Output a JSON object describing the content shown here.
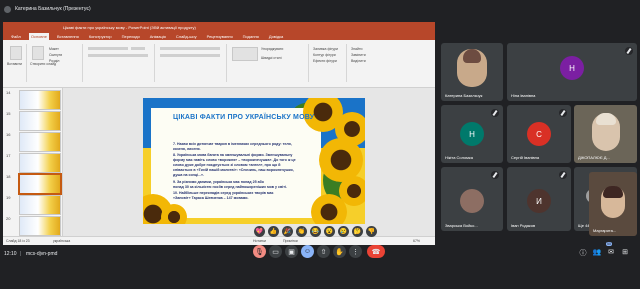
{
  "presenter": {
    "name": "Катерина Базильчук (Презентує)"
  },
  "powerpoint": {
    "window_title": "Цікаві факти про українську мову - PowerPoint (Збій активації продукту)",
    "tabs": [
      "Файл",
      "Основне",
      "Вставлення",
      "Конструктор",
      "Переходи",
      "Анімація",
      "Слайд-шоу",
      "Рецензування",
      "Подання",
      "Довідка"
    ],
    "ribbon_labels": {
      "paste": "Вставити",
      "new_slide": "Створити слайд",
      "layout": "Макет",
      "reset": "Скинути",
      "section": "Розділ",
      "arrange": "Упорядкувати",
      "quick_styles": "Швидкі стилі",
      "shape_fill": "Заливка фігури",
      "shape_outline": "Контур фігури",
      "shape_effects": "Ефекти фігури",
      "find": "Знайти",
      "replace": "Замінити",
      "select": "Виділити"
    },
    "thumb_numbers": [
      "14",
      "15",
      "16",
      "17",
      "18",
      "19",
      "20"
    ],
    "slide": {
      "heading": "ЦІКАВІ ФАКТИ ПРО УКРАЇНСЬКУ МОВУ",
      "lines": [
        "7.  Назви всіх дитинчат тварин в іменниках середнього роду: теля,",
        "     козеня, лисеня.",
        "8.  Українська мова багата на зменшувальні форми. Зменшувальну",
        "     форму має навіть слово «ворожня» – «ворожнечушка». До того ж це",
        "     слово дуже добре поєднується зі словом «ангел», про що й",
        "     співається в «Тихій нашій молитві»: «Спочинь, наш ворожнечушко,",
        "     душа на сонці...».",
        "9.  За різними даними, українська має понад 25 або",
        "     понад 30 за кількістю носіїв серед найпоширеніших мов у світі.",
        "10. Найбільше перекладів серед українських творів має",
        "     «Заповіт» Тараса Шевченка – 147 мовами."
      ]
    },
    "status": {
      "slide_counter": "Слайд 18 із 23",
      "language": "українська",
      "notes": "Нотатки",
      "comments": "Примітки",
      "zoom": "67%"
    }
  },
  "participants": [
    {
      "name": "Катерина Базильчук",
      "initial": "",
      "avatar_color": "#6d4c41"
    },
    {
      "name": "Ніна Іванівна",
      "initial": "Н",
      "avatar_color": "#7b1fa2"
    },
    {
      "name": "Нікіта Соломка",
      "initial": "Н",
      "avatar_color": "#00796b"
    },
    {
      "name": "Сергій Іванівна",
      "initial": "С",
      "avatar_color": "#d93025"
    },
    {
      "name": "ДЖОПАЛЮЄ Д...",
      "initial": "",
      "avatar_color": "#5f6368"
    },
    {
      "name": "Зварська Войко...",
      "initial": "",
      "avatar_color": "#5f6368"
    },
    {
      "name": "Іван Родаков",
      "initial": "И",
      "avatar_color": "#4e342e"
    },
    {
      "name": "Ще 44 особи",
      "initial": "",
      "avatar_color": "#5f6368"
    },
    {
      "name": "Маргарита...",
      "initial": "",
      "avatar_color": "#5f6368"
    }
  ],
  "meeting": {
    "time": "12:10",
    "separator": "|",
    "code": "mcs-djvn-pmd",
    "participant_count": "50"
  },
  "reactions": [
    "💖",
    "👍",
    "🎉",
    "👏",
    "😂",
    "😮",
    "😢",
    "🤔",
    "👎"
  ],
  "colors": {
    "accent": "#8ab4f8",
    "leave": "#ea4335",
    "ppt_brand": "#b7472a"
  }
}
